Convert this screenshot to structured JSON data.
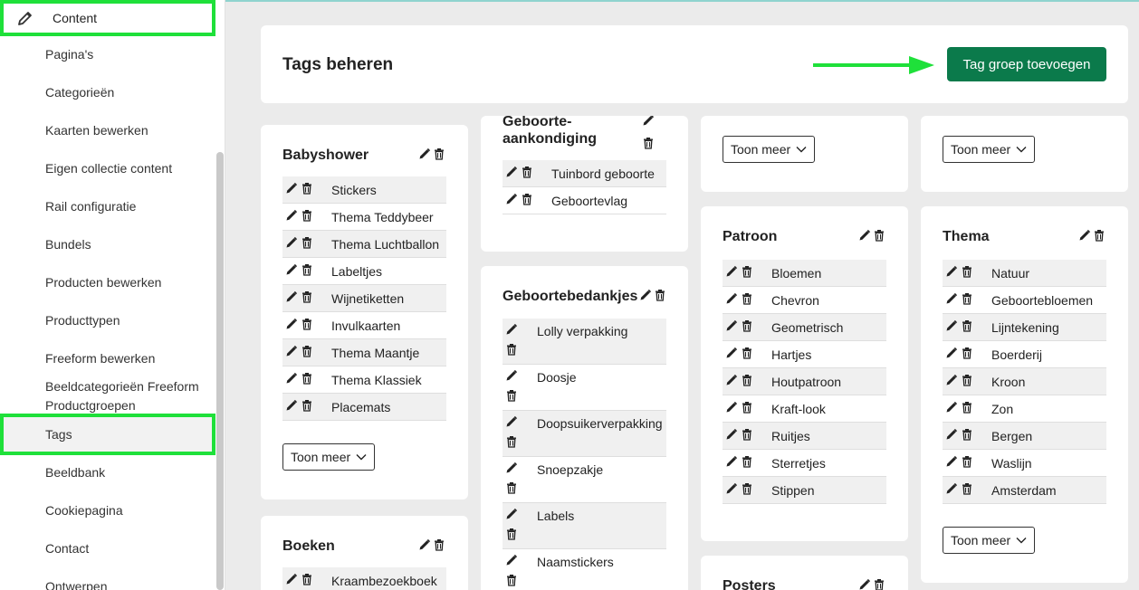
{
  "sidebar": {
    "content_label": "Content",
    "items": [
      "Pagina's",
      "Categorieën",
      "Kaarten bewerken",
      "Eigen collectie content",
      "Rail configuratie",
      "Bundels",
      "Producten bewerken",
      "Producttypen",
      "Freeform bewerken",
      "Beeldcategorieën Freeform Productgroepen",
      "Tags",
      "Beeldbank",
      "Cookiepagina",
      "Contact",
      "Ontwerpen"
    ]
  },
  "header": {
    "title": "Tags beheren",
    "add_button": "Tag groep toevoegen"
  },
  "more_label": "Toon meer",
  "groups": {
    "babyshower": {
      "title": "Babyshower",
      "tags": [
        "Stickers",
        "Thema Teddybeer",
        "Thema Luchtballon",
        "Labeltjes",
        "Wijnetiketten",
        "Invulkaarten",
        "Thema Maantje",
        "Thema Klassiek",
        "Placemats"
      ]
    },
    "boeken": {
      "title": "Boeken",
      "tags": [
        "Kraambezoekboek"
      ]
    },
    "geboorteaankondiging": {
      "title": "Geboorte-aankondiging",
      "tags": [
        "Tuinbord geboorte",
        "Geboortevlag"
      ]
    },
    "geboortebedankjes": {
      "title": "Geboortebedankjes",
      "tags": [
        "Lolly verpakking",
        "Doosje",
        "Doopsuikerverpakking",
        "Snoepzakje",
        "Labels",
        "Naamstickers"
      ]
    },
    "patroon": {
      "title": "Patroon",
      "tags": [
        "Bloemen",
        "Chevron",
        "Geometrisch",
        "Hartjes",
        "Houtpatroon",
        "Kraft-look",
        "Ruitjes",
        "Sterretjes",
        "Stippen"
      ]
    },
    "posters": {
      "title": "Posters"
    },
    "thema": {
      "title": "Thema",
      "tags": [
        "Natuur",
        "Geboortebloemen",
        "Lijntekening",
        "Boerderij",
        "Kroon",
        "Zon",
        "Bergen",
        "Waslijn",
        "Amsterdam"
      ]
    }
  }
}
